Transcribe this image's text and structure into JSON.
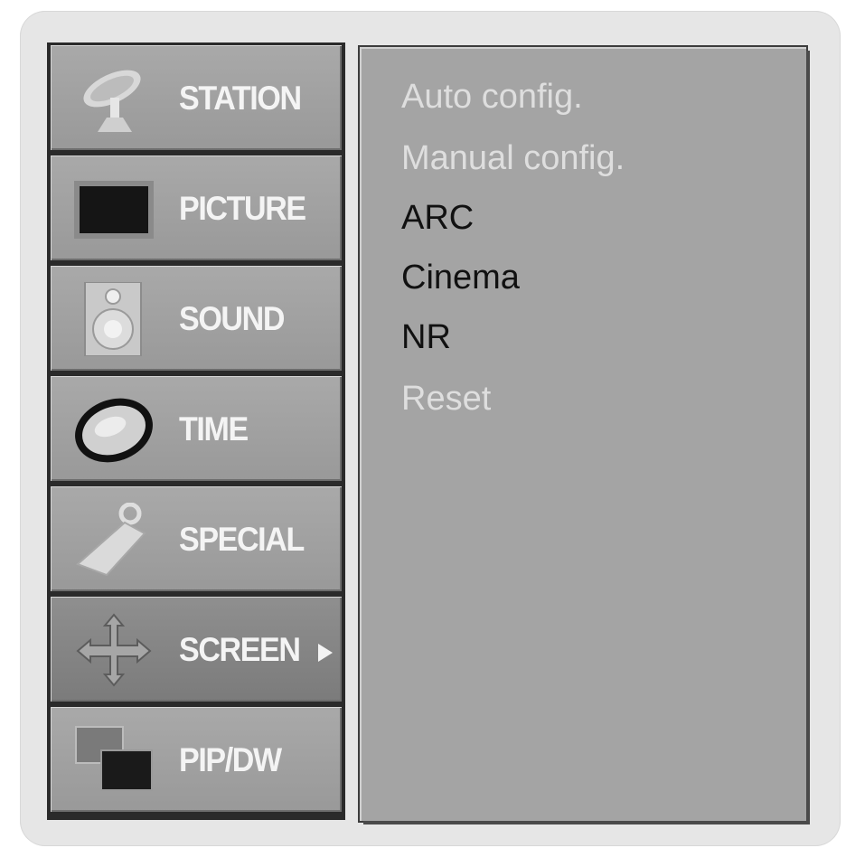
{
  "menu": {
    "items": [
      {
        "label": "STATION",
        "icon": "satellite-dish-icon",
        "selected": false
      },
      {
        "label": "PICTURE",
        "icon": "tv-screen-icon",
        "selected": false
      },
      {
        "label": "SOUND",
        "icon": "speaker-icon",
        "selected": false
      },
      {
        "label": "TIME",
        "icon": "clock-icon",
        "selected": false
      },
      {
        "label": "SPECIAL",
        "icon": "key-tag-icon",
        "selected": false
      },
      {
        "label": "SCREEN",
        "icon": "move-arrows-icon",
        "selected": true
      },
      {
        "label": "PIP/DW",
        "icon": "dual-window-icon",
        "selected": false
      }
    ]
  },
  "submenu": {
    "options": [
      {
        "label": "Auto config.",
        "enabled": false
      },
      {
        "label": "Manual config.",
        "enabled": false
      },
      {
        "label": "ARC",
        "enabled": true
      },
      {
        "label": "Cinema",
        "enabled": true
      },
      {
        "label": "NR",
        "enabled": true
      },
      {
        "label": "Reset",
        "enabled": false
      }
    ]
  },
  "colors": {
    "menu_bg": "#a4a4a4",
    "selected_bg": "#858585",
    "label_text": "#f4f4f4",
    "enabled_text": "#111111",
    "disabled_text": "#dedede"
  }
}
